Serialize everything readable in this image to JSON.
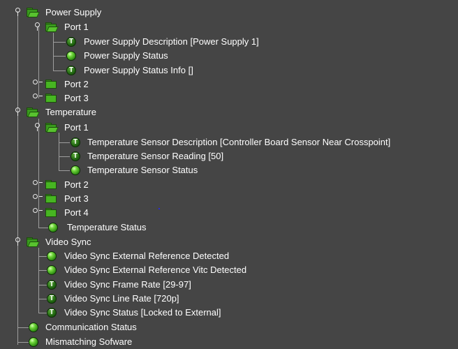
{
  "tree": {
    "power_supply": {
      "label": "Power Supply",
      "port1": {
        "label": "Port 1",
        "description": "Power Supply Description [Power Supply 1]",
        "status": "Power Supply Status",
        "status_info": "Power Supply Status Info []"
      },
      "port2": "Port 2",
      "port3": "Port 3"
    },
    "temperature": {
      "label": "Temperature",
      "port1": {
        "label": "Port 1",
        "description": "Temperature Sensor Description [Controller Board Sensor Near Crosspoint]",
        "reading": "Temperature Sensor Reading [50]",
        "status": "Temperature Sensor Status"
      },
      "port2": "Port 2",
      "port3": "Port 3",
      "port4": "Port 4",
      "status": "Temperature Status"
    },
    "video_sync": {
      "label": "Video Sync",
      "ext_ref_detected": "Video Sync External Reference Detected",
      "ext_ref_vitc_detected": "Video Sync External Reference Vitc Detected",
      "frame_rate": "Video Sync Frame Rate [29-97]",
      "line_rate": "Video Sync Line Rate [720p]",
      "status": "Video Sync Status [Locked to External]"
    },
    "communication_status": "Communication Status",
    "mismatching_software": "Mismatching Sofware"
  },
  "icons": {
    "text_glyph": "T",
    "status_color": "#3fae1c",
    "folder_color": "#3a9a1e",
    "background": "#454545"
  }
}
